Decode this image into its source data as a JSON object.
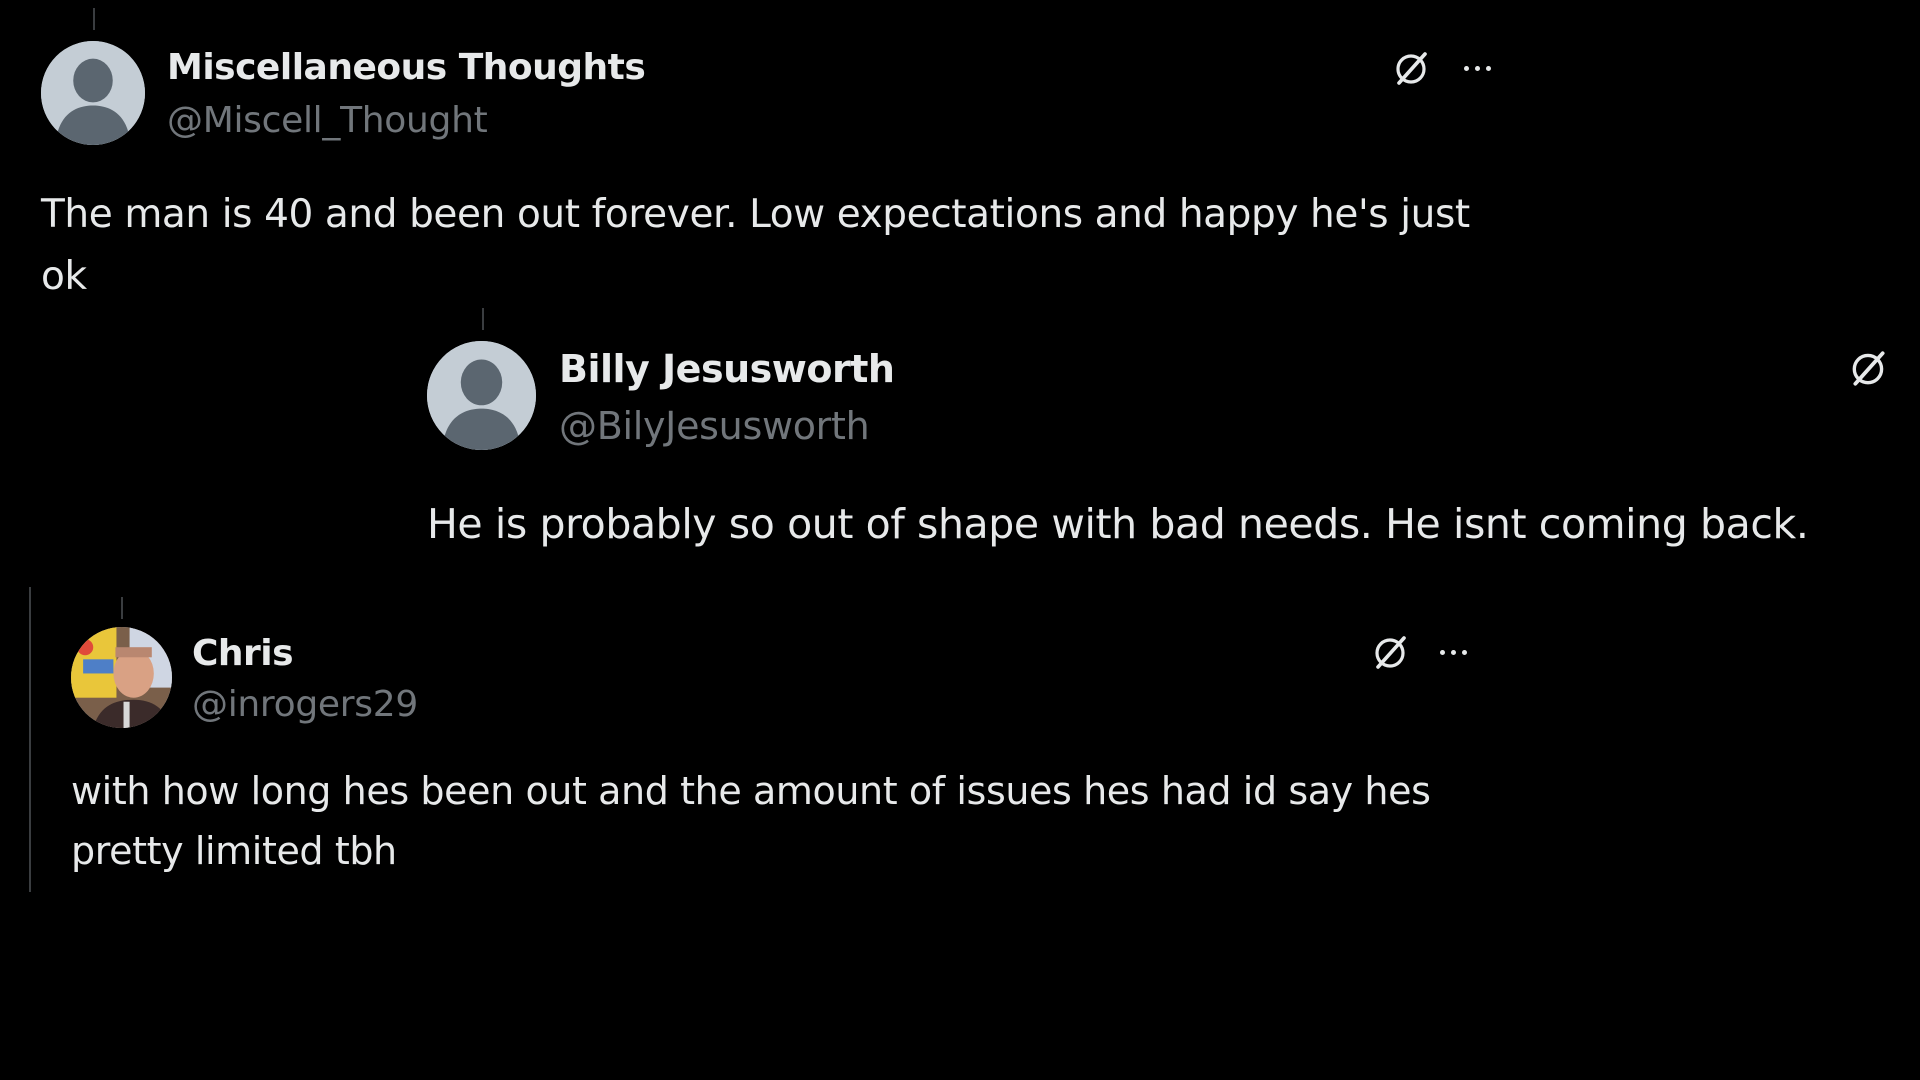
{
  "posts": [
    {
      "name": "Miscellaneous Thoughts",
      "handle": "@Miscell_Thought",
      "text_lines": [
        "The man is 40 and been out forever. Low expectations and happy he's just",
        "ok"
      ],
      "avatar": "default-avatar"
    },
    {
      "name": "Billy Jesusworth",
      "handle": "@BilyJesusworth",
      "text_lines": [
        "He is probably so out of shape with bad needs. He isnt coming back."
      ],
      "avatar": "default-avatar"
    },
    {
      "name": "Chris",
      "handle": "@inrogers29",
      "text_lines": [
        "with how long hes been out and the amount of issues hes had id say hes",
        "pretty limited tbh"
      ],
      "avatar": "photo-avatar"
    }
  ],
  "icons": {
    "grok": "grok-icon",
    "more": "more-options-icon"
  },
  "colors": {
    "background": "#000000",
    "text": "#e7e9ea",
    "secondary": "#71767b"
  }
}
